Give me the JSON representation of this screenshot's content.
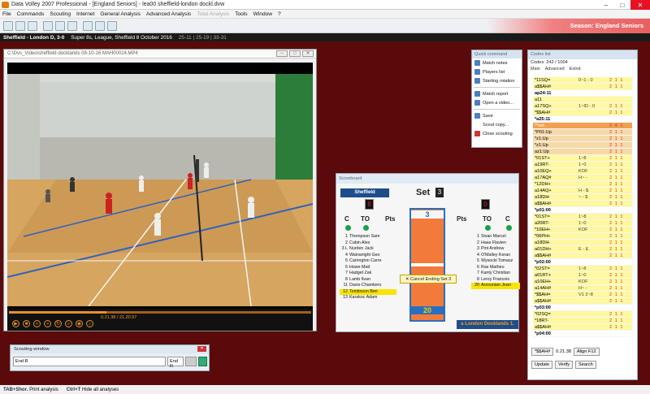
{
  "window": {
    "title": "Data Volley 2007 Professional - [England Seniors] - lea00 sheffield-london dockl.dvw"
  },
  "menu": [
    {
      "label": "File"
    },
    {
      "label": "Commands"
    },
    {
      "label": "Scouting"
    },
    {
      "label": "Internet"
    },
    {
      "label": "General Analysis"
    },
    {
      "label": "Advanced Analysis"
    },
    {
      "label": "Total Analysis",
      "disabled": true
    },
    {
      "label": "Tools"
    },
    {
      "label": "Window"
    },
    {
      "label": "?"
    }
  ],
  "season": "Season: England Seniors",
  "match": {
    "teams": "Sheffield - London D, 3-0",
    "info": "Super 8s, League, Sheffield 8 October 2016",
    "sets": "25-11 | 25-19 | 33-31"
  },
  "video": {
    "path": "C:\\Dvs_Video\\sheffield-docklands 08-10-16 MAH00024.MP4",
    "time_current": "0.21.38",
    "time_total": "21.20.57"
  },
  "quick": {
    "title": "Quick command",
    "items": [
      {
        "label": "Match notes"
      },
      {
        "label": "Players list"
      },
      {
        "label": "Starting rotation"
      },
      {
        "label": "Match report"
      },
      {
        "label": "Open a video..."
      },
      {
        "label": "Save"
      },
      {
        "label": "Scout copy..."
      },
      {
        "label": "Close scouting"
      }
    ]
  },
  "scoreboard": {
    "title": "Scoreboard",
    "team_left": "Sheffield",
    "set_label": "Set",
    "set_value": "3",
    "left_digit": "8",
    "right_digit": "0",
    "c": "C",
    "to": "TO",
    "pts": "Pts",
    "score_top": "3",
    "score_bottom": "20",
    "cancel_label": "Cancel Ending Set 3",
    "team_right": "a London Docklands 1.",
    "left_players": [
      {
        "n": "1",
        "name": "Thompson Sam"
      },
      {
        "n": "2",
        "name": "Cabin Alex"
      },
      {
        "n": "3 L",
        "name": "Nurden Jack"
      },
      {
        "n": "4",
        "name": "Wainwright Geo"
      },
      {
        "n": "5",
        "name": "Carrington Carre"
      },
      {
        "n": "6",
        "name": "Howe Matt"
      },
      {
        "n": "7",
        "name": "Hadget Zak"
      },
      {
        "n": "8",
        "name": "Lamb Ilvan"
      },
      {
        "n": "11",
        "name": "Davis-Chambers"
      },
      {
        "n": "12",
        "name": "Tomlinson Ben",
        "hl": true
      },
      {
        "n": "13",
        "name": "Karakoc Adam"
      }
    ],
    "right_players": [
      {
        "n": "1",
        "name": "Sivan Marcel"
      },
      {
        "n": "2",
        "name": "Haas Flavien"
      },
      {
        "n": "3",
        "name": "Pint Andrew"
      },
      {
        "n": "4",
        "name": "O'Malley Keran"
      },
      {
        "n": "5",
        "name": "Wysocki Tomasz"
      },
      {
        "n": "6",
        "name": "Ras Matheu"
      },
      {
        "n": "7",
        "name": "Kanty Christian"
      },
      {
        "n": "8",
        "name": "Leroy Francois"
      },
      {
        "n": "20",
        "name": "Arzounian Jean",
        "hl": true
      }
    ]
  },
  "codes": {
    "title": "Codes list",
    "count": "Codes: 242 / 1004",
    "col_main": "Main",
    "col_adv": "Advanced",
    "col_ext": "Extnd",
    "rows": [
      {
        "m": "*11SQ=",
        "a": "0~1 - 0",
        "e": "2 1 1",
        "t": "y"
      },
      {
        "m": "a$$AH#",
        "a": "",
        "e": "2 1 1",
        "t": "y"
      },
      {
        "m": "ap24:11",
        "a": "",
        "e": "",
        "t": "b"
      },
      {
        "m": "a11",
        "a": "",
        "e": "",
        "t": "y"
      },
      {
        "m": "a17SQ+",
        "a": "1~ID - 0",
        "e": "2 1 1",
        "t": "y"
      },
      {
        "m": "*$$AH#",
        "a": "",
        "e": "2 1 1",
        "t": "y"
      },
      {
        "m": "*a25:11",
        "a": "",
        "e": "",
        "t": "b"
      },
      {
        "m": "**set",
        "a": "",
        "e": "2 4 1",
        "t": "d"
      },
      {
        "m": "*P01:Up",
        "a": "",
        "e": "2 1 1",
        "t": "o"
      },
      {
        "m": "*z1:Up",
        "a": "",
        "e": "2 1 1",
        "t": "o"
      },
      {
        "m": "*z1:Up",
        "a": "",
        "e": "2 1 1",
        "t": "o"
      },
      {
        "m": "az1:Up",
        "a": "",
        "e": "2 1 1",
        "t": "o"
      },
      {
        "m": "*01ST+",
        "a": "1~8",
        "e": "2 1 1",
        "t": "y"
      },
      {
        "m": "a19RT-",
        "a": "1~0",
        "e": "2 1 1",
        "t": "y"
      },
      {
        "m": "a10EQ+",
        "a": "KOF",
        "e": "2 1 1",
        "t": "y"
      },
      {
        "m": "a17AQ#",
        "a": "H~ -",
        "e": "2 1 1",
        "t": "y"
      },
      {
        "m": "*12DH+",
        "a": "",
        "e": "2 1 1",
        "t": "y"
      },
      {
        "m": "a14AQ+",
        "a": "H - $",
        "e": "2 1 1",
        "t": "y"
      },
      {
        "m": "a18DH-",
        "a": "~ - $",
        "e": "2 1 1",
        "t": "y"
      },
      {
        "m": "a$$AH#",
        "a": "",
        "e": "2 1 1",
        "t": "y"
      },
      {
        "m": "*p01:00",
        "a": "",
        "e": "",
        "t": "b"
      },
      {
        "m": "*01ST=",
        "a": "1~8",
        "e": "2 1 1",
        "t": "y"
      },
      {
        "m": "a20RT-",
        "a": "1~0",
        "e": "2 1 1",
        "t": "y"
      },
      {
        "m": "*10EH+",
        "a": "KOF",
        "e": "2 1 1",
        "t": "y"
      },
      {
        "m": "*06PH+",
        "a": "",
        "e": "2 1 1",
        "t": "y"
      },
      {
        "m": "a18DH-",
        "a": "",
        "e": "2 1 1",
        "t": "y"
      },
      {
        "m": "a01DH+",
        "a": "E - E",
        "e": "2 1 1",
        "t": "y"
      },
      {
        "m": "a$$AH#",
        "a": "",
        "e": "2 1 1",
        "t": "y"
      },
      {
        "m": "*p02:00",
        "a": "",
        "e": "",
        "t": "b"
      },
      {
        "m": "*02ST=",
        "a": "1~8",
        "e": "2 1 1",
        "t": "y"
      },
      {
        "m": "a01RT+",
        "a": "1~0",
        "e": "2 1 1",
        "t": "y"
      },
      {
        "m": "a10EH+",
        "a": "KOF",
        "e": "2 1 1",
        "t": "y"
      },
      {
        "m": "a14AH#",
        "a": "H~ -",
        "e": "2 1 1",
        "t": "y"
      },
      {
        "m": "*$$AH=",
        "a": "V1 2~8",
        "e": "2 1 1",
        "t": "y"
      },
      {
        "m": "a$$AH#",
        "a": "",
        "e": "2 1 1",
        "t": "y"
      },
      {
        "m": "*p03:00",
        "a": "",
        "e": "",
        "t": "b"
      },
      {
        "m": "*02SQ=",
        "a": "",
        "e": "2 1 1",
        "t": "y"
      },
      {
        "m": "*18RT-",
        "a": "",
        "e": "2 1 1",
        "t": "y"
      },
      {
        "m": "a$$AH#",
        "a": "",
        "e": "2 1 1",
        "t": "y"
      },
      {
        "m": "*p04:00",
        "a": "",
        "e": "",
        "t": "b"
      }
    ],
    "input": "*$$AH#",
    "input_time": "0.21.38",
    "align": "Align F12",
    "update": "Update",
    "verify": "Verify",
    "search": "Search"
  },
  "scout": {
    "title": "Scouting window",
    "end_r_left": "End R",
    "end_r_mid": "End R",
    "end_r_right": "End R"
  },
  "status": {
    "k1": "TAB+Shor.",
    "t1": "Print analysis",
    "k2": "Ctrl+T",
    "t2": "Hide all analyses"
  }
}
